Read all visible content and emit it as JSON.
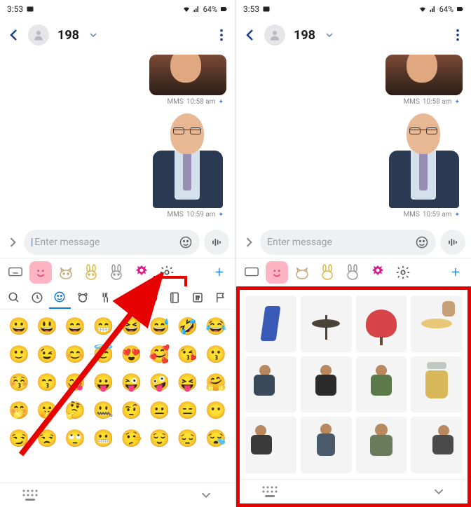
{
  "status": {
    "time": "3:53",
    "battery": "64%"
  },
  "header": {
    "contact": "198"
  },
  "messages": [
    {
      "meta_prefix": "MMS",
      "meta_time": "10:58 am"
    },
    {
      "meta_prefix": "MMS",
      "meta_time": "10:59 am"
    }
  ],
  "compose": {
    "placeholder": "Enter message"
  },
  "keyboard": {
    "tabs": [
      "keyboard",
      "smiley",
      "cat",
      "bunny",
      "bunny2",
      "magenta",
      "settings",
      "plus"
    ],
    "emoji_categories": [
      "search",
      "recent",
      "smiley",
      "animal",
      "food",
      "activity",
      "sport",
      "objects",
      "symbols",
      "flags"
    ],
    "emojis": [
      "😀",
      "😃",
      "😄",
      "😁",
      "😆",
      "😅",
      "🤣",
      "😂",
      "🙂",
      "😉",
      "😊",
      "😇",
      "😍",
      "🥰",
      "😘",
      "😗",
      "😚",
      "😙",
      "😋",
      "😛",
      "😜",
      "🤪",
      "😝",
      "🤗",
      "🤭",
      "🤫",
      "🤔",
      "🤐",
      "🤨",
      "😐",
      "😑",
      "😶",
      "😏",
      "😒",
      "🙄",
      "😬",
      "🤥",
      "😌",
      "😔",
      "😪"
    ]
  },
  "sticker_grid": {
    "items": [
      "towel",
      "lamp",
      "tree",
      "plate",
      "man-sitting-1",
      "man-sitting-2",
      "man-sitting-3",
      "jar",
      "man-alt-1",
      "man-alt-2",
      "man-alt-3",
      "man-alt-4"
    ]
  }
}
